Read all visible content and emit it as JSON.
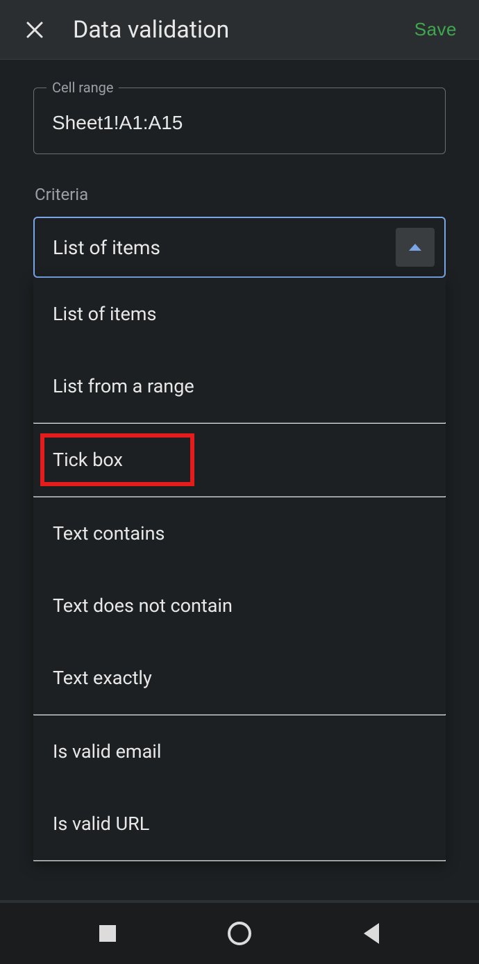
{
  "header": {
    "title": "Data validation",
    "save_label": "Save"
  },
  "cell_range": {
    "label": "Cell range",
    "value": "Sheet1!A1:A15"
  },
  "criteria": {
    "label": "Criteria",
    "selected": "List of items",
    "options": [
      "List of items",
      "List from a range",
      "Tick box",
      "Text contains",
      "Text does not contain",
      "Text exactly",
      "Is valid email",
      "Is valid URL"
    ],
    "highlighted_index": 2
  }
}
